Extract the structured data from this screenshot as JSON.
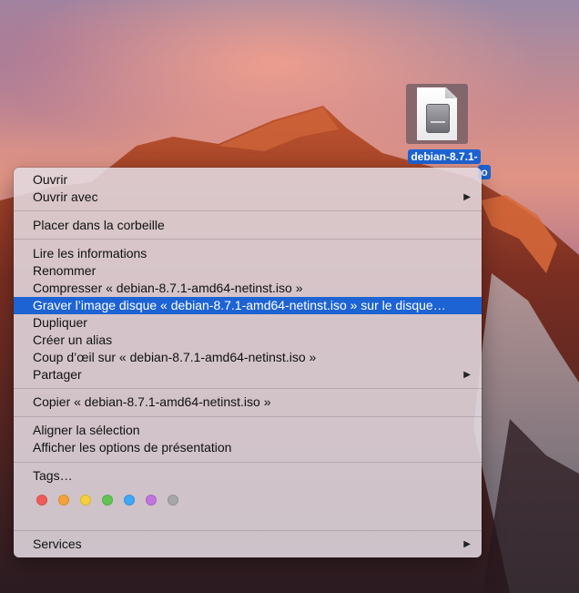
{
  "desktop": {
    "file": {
      "label_line1": "debian-8.7.1-",
      "label_line2": "o",
      "icon": "disk-image-icon"
    }
  },
  "context_menu": {
    "items": [
      {
        "label": "Ouvrir"
      },
      {
        "label": "Ouvrir avec",
        "submenu": true
      },
      {
        "label": "Placer dans la corbeille"
      },
      {
        "label": "Lire les informations"
      },
      {
        "label": "Renommer"
      },
      {
        "label": "Compresser « debian-8.7.1-amd64-netinst.iso »"
      },
      {
        "label": "Graver l’image disque « debian-8.7.1-amd64-netinst.iso » sur le disque…",
        "selected": true
      },
      {
        "label": "Dupliquer"
      },
      {
        "label": "Créer un alias"
      },
      {
        "label": "Coup d’œil sur « debian-8.7.1-amd64-netinst.iso »"
      },
      {
        "label": "Partager",
        "submenu": true
      },
      {
        "label": "Copier « debian-8.7.1-amd64-netinst.iso »"
      },
      {
        "label": "Aligner la sélection"
      },
      {
        "label": "Afficher les options de présentation"
      },
      {
        "label": "Tags…"
      },
      {
        "label": "Services",
        "submenu": true
      }
    ],
    "submenu_arrow": "▶",
    "tag_colors": [
      "#f05a5a",
      "#f4a13a",
      "#f3d03c",
      "#60c553",
      "#40a7f4",
      "#c274e0",
      "#a7a7a9"
    ]
  }
}
